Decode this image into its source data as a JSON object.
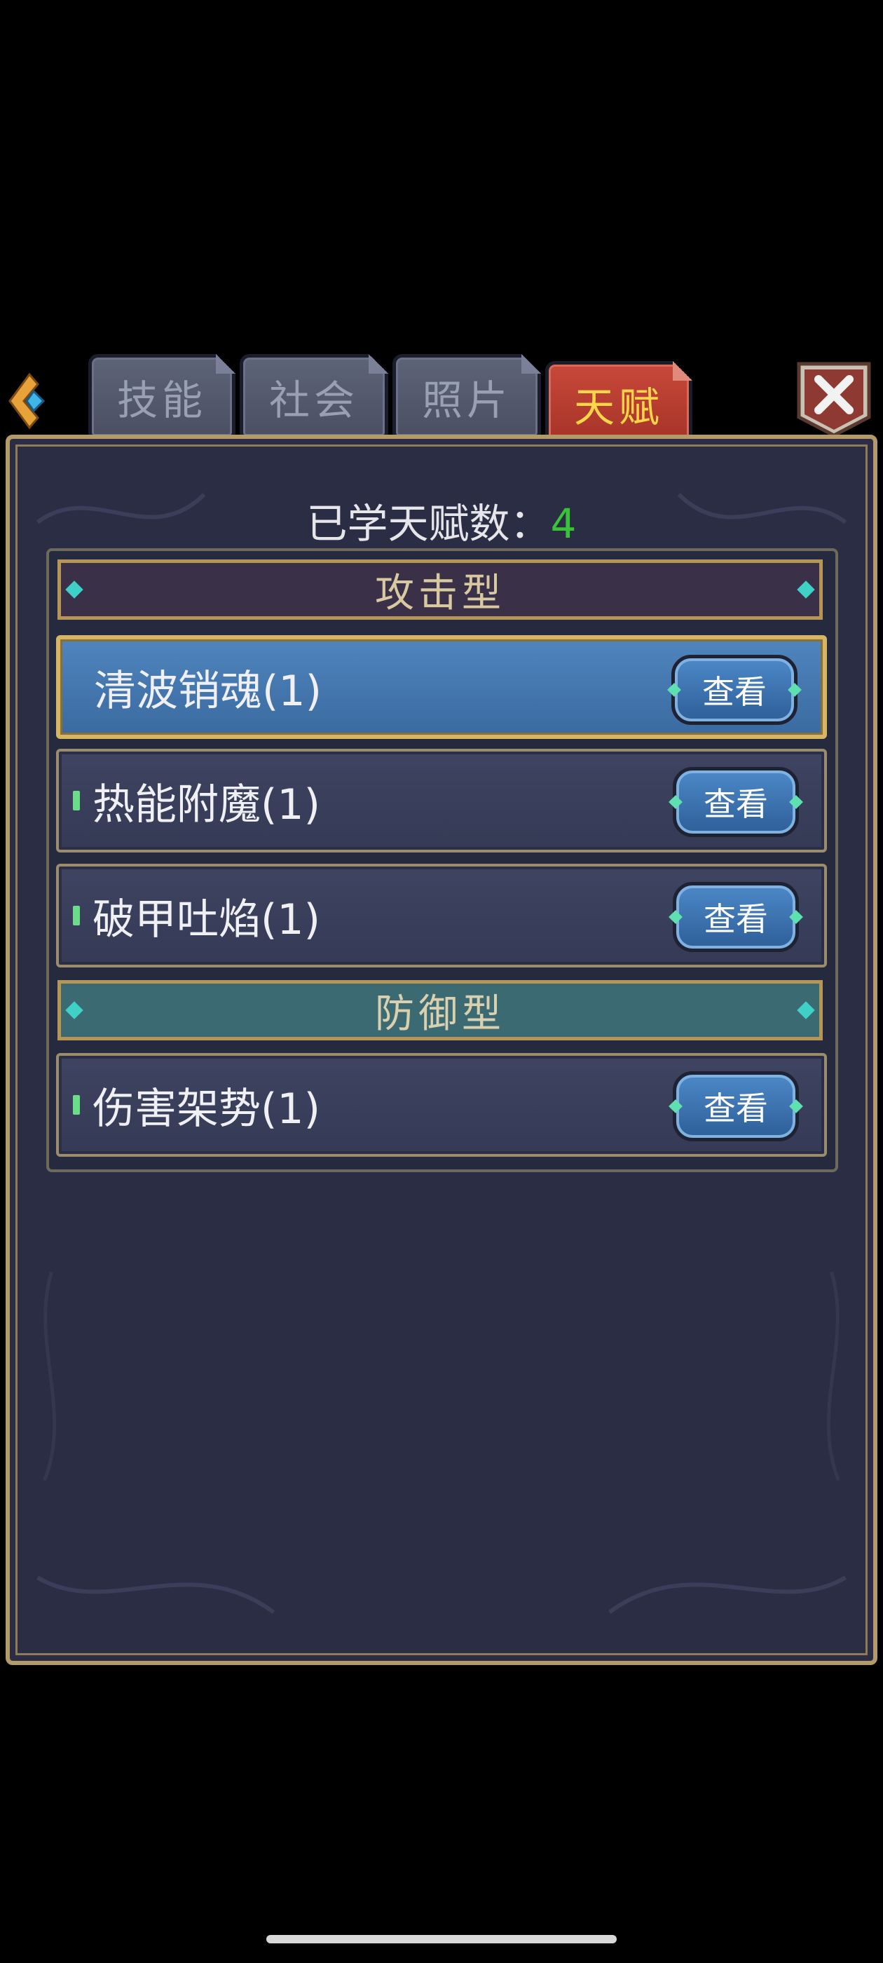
{
  "navigation": {
    "back_icon": "back-arrow-gem-icon",
    "close_icon": "close-x-icon"
  },
  "tabs": [
    {
      "label": "技能",
      "active": false
    },
    {
      "label": "社会",
      "active": false
    },
    {
      "label": "照片",
      "active": false
    },
    {
      "label": "天赋",
      "active": true
    }
  ],
  "summary": {
    "label": "已学天赋数：",
    "count": "4",
    "count_color": "#39c23a"
  },
  "sections": [
    {
      "title": "攻击型",
      "talents": [
        {
          "name": "清波销魂(1)",
          "button": "查看",
          "selected": true
        },
        {
          "name": "热能附魔(1)",
          "button": "查看",
          "selected": false
        },
        {
          "name": "破甲吐焰(1)",
          "button": "查看",
          "selected": false
        }
      ]
    },
    {
      "title": "防御型",
      "talents": [
        {
          "name": "伤害架势(1)",
          "button": "查看",
          "selected": false
        }
      ]
    }
  ],
  "colors": {
    "panel": "#2a2d44",
    "active_tab": "#c8483a",
    "active_tab_text": "#ffd54a",
    "frame_gold": "#b39a6a"
  }
}
